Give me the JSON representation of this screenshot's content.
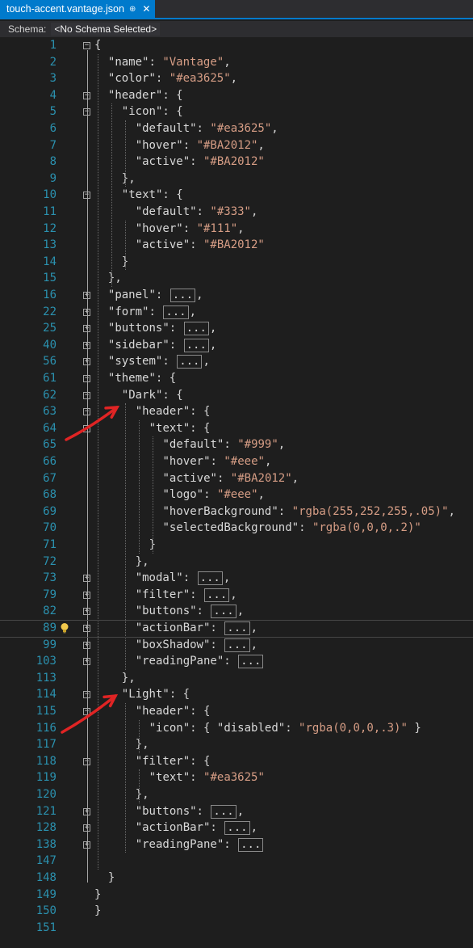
{
  "tab": {
    "title": "touch-accent.vantage.json",
    "pin": "⊕",
    "close": "✕"
  },
  "schema": {
    "label": "Schema:",
    "value": "<No Schema Selected>"
  },
  "lines": [
    {
      "n": "1",
      "p": [
        [
          "p",
          "{"
        ]
      ]
    },
    {
      "n": "2",
      "p": [
        [
          "k",
          "\"name\""
        ],
        [
          "p",
          ": "
        ],
        [
          "s",
          "\"Vantage\""
        ],
        [
          "p",
          ","
        ]
      ]
    },
    {
      "n": "3",
      "p": [
        [
          "k",
          "\"color\""
        ],
        [
          "p",
          ": "
        ],
        [
          "s",
          "\"#ea3625\""
        ],
        [
          "p",
          ","
        ]
      ]
    },
    {
      "n": "4",
      "p": [
        [
          "k",
          "\"header\""
        ],
        [
          "p",
          ": {"
        ]
      ]
    },
    {
      "n": "5",
      "p": [
        [
          "k",
          "\"icon\""
        ],
        [
          "p",
          ": {"
        ]
      ]
    },
    {
      "n": "6",
      "p": [
        [
          "k",
          "\"default\""
        ],
        [
          "p",
          ": "
        ],
        [
          "s",
          "\"#ea3625\""
        ],
        [
          "p",
          ","
        ]
      ]
    },
    {
      "n": "7",
      "p": [
        [
          "k",
          "\"hover\""
        ],
        [
          "p",
          ": "
        ],
        [
          "s",
          "\"#BA2012\""
        ],
        [
          "p",
          ","
        ]
      ]
    },
    {
      "n": "8",
      "p": [
        [
          "k",
          "\"active\""
        ],
        [
          "p",
          ": "
        ],
        [
          "s",
          "\"#BA2012\""
        ]
      ]
    },
    {
      "n": "9",
      "p": [
        [
          "p",
          "},"
        ]
      ]
    },
    {
      "n": "10",
      "p": [
        [
          "k",
          "\"text\""
        ],
        [
          "p",
          ": {"
        ]
      ]
    },
    {
      "n": "11",
      "p": [
        [
          "k",
          "\"default\""
        ],
        [
          "p",
          ": "
        ],
        [
          "s",
          "\"#333\""
        ],
        [
          "p",
          ","
        ]
      ]
    },
    {
      "n": "12",
      "p": [
        [
          "k",
          "\"hover\""
        ],
        [
          "p",
          ": "
        ],
        [
          "s",
          "\"#111\""
        ],
        [
          "p",
          ","
        ]
      ]
    },
    {
      "n": "13",
      "p": [
        [
          "k",
          "\"active\""
        ],
        [
          "p",
          ": "
        ],
        [
          "s",
          "\"#BA2012\""
        ]
      ]
    },
    {
      "n": "14",
      "p": [
        [
          "p",
          "}"
        ]
      ]
    },
    {
      "n": "15",
      "p": [
        [
          "p",
          "},"
        ]
      ]
    },
    {
      "n": "16",
      "p": [
        [
          "k",
          "\"panel\""
        ],
        [
          "p",
          ": "
        ],
        [
          "c",
          "..."
        ],
        [
          "p",
          ","
        ]
      ]
    },
    {
      "n": "22",
      "p": [
        [
          "k",
          "\"form\""
        ],
        [
          "p",
          ": "
        ],
        [
          "c",
          "..."
        ],
        [
          "p",
          ","
        ]
      ]
    },
    {
      "n": "25",
      "p": [
        [
          "k",
          "\"buttons\""
        ],
        [
          "p",
          ": "
        ],
        [
          "c",
          "..."
        ],
        [
          "p",
          ","
        ]
      ]
    },
    {
      "n": "40",
      "p": [
        [
          "k",
          "\"sidebar\""
        ],
        [
          "p",
          ": "
        ],
        [
          "c",
          "..."
        ],
        [
          "p",
          ","
        ]
      ]
    },
    {
      "n": "56",
      "p": [
        [
          "k",
          "\"system\""
        ],
        [
          "p",
          ": "
        ],
        [
          "c",
          "..."
        ],
        [
          "p",
          ","
        ]
      ]
    },
    {
      "n": "61",
      "p": [
        [
          "k",
          "\"theme\""
        ],
        [
          "p",
          ": {"
        ]
      ]
    },
    {
      "n": "62",
      "p": [
        [
          "k",
          "\"Dark\""
        ],
        [
          "p",
          ": {"
        ]
      ]
    },
    {
      "n": "63",
      "p": [
        [
          "k",
          "\"header\""
        ],
        [
          "p",
          ": {"
        ]
      ]
    },
    {
      "n": "64",
      "p": [
        [
          "k",
          "\"text\""
        ],
        [
          "p",
          ": {"
        ]
      ]
    },
    {
      "n": "65",
      "p": [
        [
          "k",
          "\"default\""
        ],
        [
          "p",
          ": "
        ],
        [
          "s",
          "\"#999\""
        ],
        [
          "p",
          ","
        ]
      ]
    },
    {
      "n": "66",
      "p": [
        [
          "k",
          "\"hover\""
        ],
        [
          "p",
          ": "
        ],
        [
          "s",
          "\"#eee\""
        ],
        [
          "p",
          ","
        ]
      ]
    },
    {
      "n": "67",
      "p": [
        [
          "k",
          "\"active\""
        ],
        [
          "p",
          ": "
        ],
        [
          "s",
          "\"#BA2012\""
        ],
        [
          "p",
          ","
        ]
      ]
    },
    {
      "n": "68",
      "p": [
        [
          "k",
          "\"logo\""
        ],
        [
          "p",
          ": "
        ],
        [
          "s",
          "\"#eee\""
        ],
        [
          "p",
          ","
        ]
      ]
    },
    {
      "n": "69",
      "p": [
        [
          "k",
          "\"hoverBackground\""
        ],
        [
          "p",
          ": "
        ],
        [
          "s",
          "\"rgba(255,252,255,.05)\""
        ],
        [
          "p",
          ","
        ]
      ]
    },
    {
      "n": "70",
      "p": [
        [
          "k",
          "\"selectedBackground\""
        ],
        [
          "p",
          ": "
        ],
        [
          "s",
          "\"rgba(0,0,0,.2)\""
        ]
      ]
    },
    {
      "n": "71",
      "p": [
        [
          "p",
          "}"
        ]
      ]
    },
    {
      "n": "72",
      "p": [
        [
          "p",
          "},"
        ]
      ]
    },
    {
      "n": "73",
      "p": [
        [
          "k",
          "\"modal\""
        ],
        [
          "p",
          ": "
        ],
        [
          "c",
          "..."
        ],
        [
          "p",
          ","
        ]
      ]
    },
    {
      "n": "79",
      "p": [
        [
          "k",
          "\"filter\""
        ],
        [
          "p",
          ": "
        ],
        [
          "c",
          "..."
        ],
        [
          "p",
          ","
        ]
      ]
    },
    {
      "n": "82",
      "p": [
        [
          "k",
          "\"buttons\""
        ],
        [
          "p",
          ": "
        ],
        [
          "c",
          "..."
        ],
        [
          "p",
          ","
        ]
      ]
    },
    {
      "n": "89",
      "p": [
        [
          "k",
          "\"actionBar\""
        ],
        [
          "p",
          ": "
        ],
        [
          "c",
          "..."
        ],
        [
          "p",
          ","
        ]
      ]
    },
    {
      "n": "99",
      "p": [
        [
          "k",
          "\"boxShadow\""
        ],
        [
          "p",
          ": "
        ],
        [
          "c",
          "..."
        ],
        [
          "p",
          ","
        ]
      ]
    },
    {
      "n": "103",
      "p": [
        [
          "k",
          "\"readingPane\""
        ],
        [
          "p",
          ": "
        ],
        [
          "c",
          "..."
        ]
      ]
    },
    {
      "n": "113",
      "p": [
        [
          "p",
          "},"
        ]
      ]
    },
    {
      "n": "114",
      "p": [
        [
          "k",
          "\"Light\""
        ],
        [
          "p",
          ": {"
        ]
      ]
    },
    {
      "n": "115",
      "p": [
        [
          "k",
          "\"header\""
        ],
        [
          "p",
          ": {"
        ]
      ]
    },
    {
      "n": "116",
      "p": [
        [
          "k",
          "\"icon\""
        ],
        [
          "p",
          ": { "
        ],
        [
          "k",
          "\"disabled\""
        ],
        [
          "p",
          ": "
        ],
        [
          "s",
          "\"rgba(0,0,0,.3)\""
        ],
        [
          "p",
          " }"
        ]
      ]
    },
    {
      "n": "117",
      "p": [
        [
          "p",
          "},"
        ]
      ]
    },
    {
      "n": "118",
      "p": [
        [
          "k",
          "\"filter\""
        ],
        [
          "p",
          ": {"
        ]
      ]
    },
    {
      "n": "119",
      "p": [
        [
          "k",
          "\"text\""
        ],
        [
          "p",
          ": "
        ],
        [
          "s",
          "\"#ea3625\""
        ]
      ]
    },
    {
      "n": "120",
      "p": [
        [
          "p",
          "},"
        ]
      ]
    },
    {
      "n": "121",
      "p": [
        [
          "k",
          "\"buttons\""
        ],
        [
          "p",
          ": "
        ],
        [
          "c",
          "..."
        ],
        [
          "p",
          ","
        ]
      ]
    },
    {
      "n": "128",
      "p": [
        [
          "k",
          "\"actionBar\""
        ],
        [
          "p",
          ": "
        ],
        [
          "c",
          "..."
        ],
        [
          "p",
          ","
        ]
      ]
    },
    {
      "n": "138",
      "p": [
        [
          "k",
          "\"readingPane\""
        ],
        [
          "p",
          ": "
        ],
        [
          "c",
          "..."
        ]
      ]
    },
    {
      "n": "147",
      "p": []
    },
    {
      "n": "148",
      "p": [
        [
          "p",
          "}"
        ]
      ]
    },
    {
      "n": "149",
      "p": [
        [
          "p",
          "}"
        ]
      ]
    },
    {
      "n": "150",
      "p": [
        [
          "p",
          "}"
        ]
      ]
    },
    {
      "n": "151",
      "p": []
    }
  ],
  "colors": {
    "accent": "#007acc",
    "lineNumber": "#2b91af",
    "string": "#d69d85",
    "arrow": "#e02424"
  }
}
